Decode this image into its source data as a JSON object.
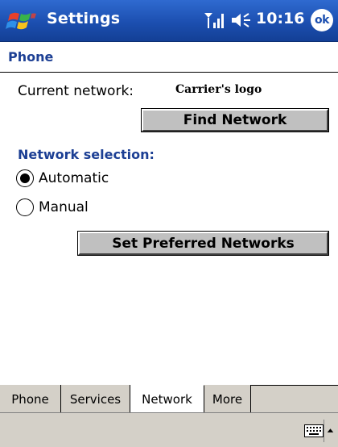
{
  "titlebar": {
    "title": "Settings",
    "time": "10:16",
    "ok_label": "ok",
    "icons": [
      "windows-start-flag-icon",
      "signal-strength-icon",
      "speaker-volume-icon"
    ]
  },
  "header": {
    "title": "Phone"
  },
  "network": {
    "current_label": "Current network:",
    "current_value": "Carrier's logo",
    "find_button": "Find Network",
    "selection_heading": "Network selection:",
    "options": [
      {
        "label": "Automatic",
        "selected": true
      },
      {
        "label": "Manual",
        "selected": false
      }
    ],
    "preferred_button": "Set Preferred Networks"
  },
  "tabs": [
    {
      "label": "Phone",
      "active": false
    },
    {
      "label": "Services",
      "active": false
    },
    {
      "label": "Network",
      "active": true
    },
    {
      "label": "More",
      "active": false
    }
  ],
  "menubar": {
    "icons": [
      "keyboard-icon",
      "sip-arrow-icon"
    ]
  },
  "colors": {
    "titlebar": "#1c4fb0",
    "heading_text": "#1c3f94",
    "button_face": "#c0c0c0",
    "tab_bar": "#d4d0c8"
  }
}
